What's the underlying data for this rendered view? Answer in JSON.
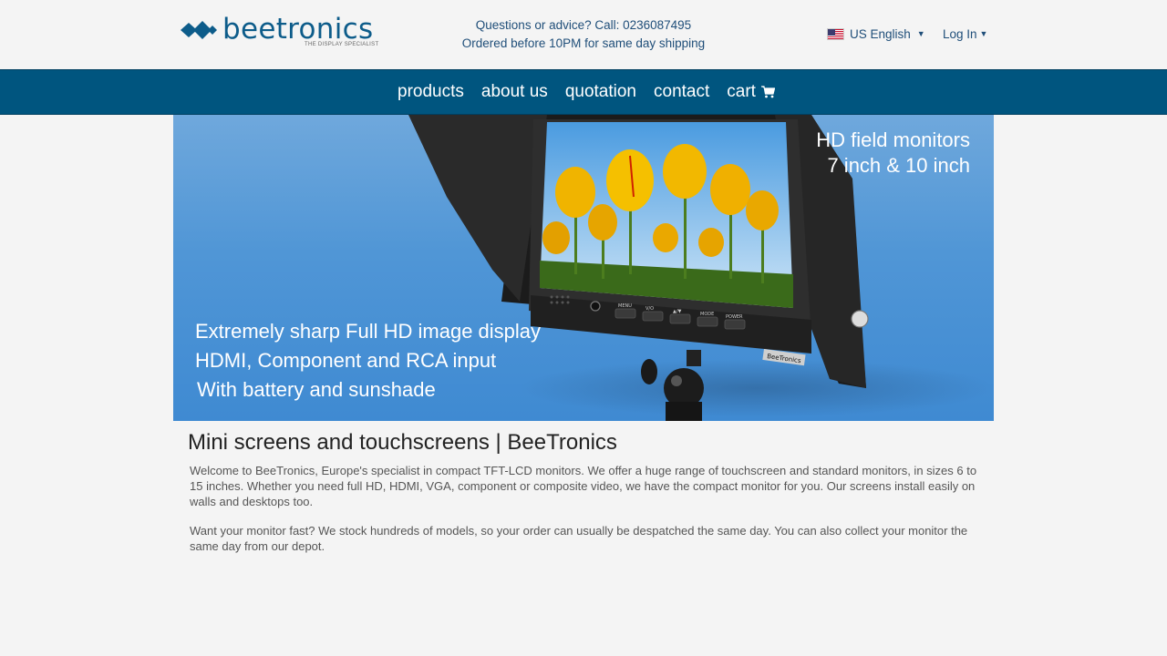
{
  "header": {
    "logo_text": "beetronics",
    "logo_tagline": "THE DISPLAY SPECIALIST",
    "contact_line1": "Questions or advice? Call: 0236087495",
    "contact_line2": "Ordered before 10PM for same day shipping",
    "language_label": "US English",
    "login_label": "Log In"
  },
  "nav": {
    "items": [
      {
        "label": "products"
      },
      {
        "label": "about us"
      },
      {
        "label": "quotation"
      },
      {
        "label": "contact"
      },
      {
        "label": "cart"
      }
    ]
  },
  "banner": {
    "headline_line1": "HD field monitors",
    "headline_line2": "7 inch & 10 inch",
    "feature1": "Extremely sharp Full HD image display",
    "feature2": "HDMI, Component and RCA input",
    "feature3": "With battery and sunshade",
    "device_brand": "BeeTronics",
    "button_labels": [
      "MENU",
      "V/O",
      "▲/▼",
      "MODE",
      "POWER"
    ]
  },
  "main": {
    "title": "Mini screens and touchscreens | BeeTronics",
    "para1_before_link": "Welcome to BeeTronics, Europe's specialist in compact ",
    "para1_link": "TFT-LCD",
    "para1_after_link": " monitors. We offer a huge range of touchscreen and standard monitors, in sizes 6 to 15 inches. Whether you need full HD, HDMI, VGA, component or composite video, we have the compact monitor for you. Our screens install easily on walls and desktops too.",
    "para2": "Want your monitor fast? We stock hundreds of models, so your order can usually be despatched the same day. You can also collect your monitor the same day from our depot."
  },
  "colors": {
    "brand_blue": "#00557f",
    "text_blue": "#1f4e79",
    "banner_blue": "#4a90d9"
  }
}
